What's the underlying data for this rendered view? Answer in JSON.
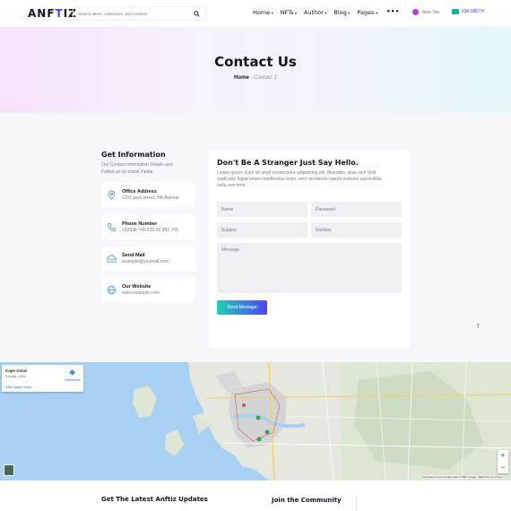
{
  "header": {
    "logo": {
      "main": "ANF",
      "accent": "T",
      "rest": "IZ"
    },
    "search_placeholder": "Search items, collections, and creators",
    "nav": [
      {
        "label": "Home",
        "caret": "▾"
      },
      {
        "label": "NFTs",
        "caret": "▾"
      },
      {
        "label": "Author",
        "caret": "▾"
      },
      {
        "label": "Blog",
        "caret": "▾"
      },
      {
        "label": "Pages",
        "caret": "▾"
      }
    ],
    "more": "•••",
    "user_name": "Alex Joe",
    "wallet_balance": "234.98ETH"
  },
  "hero": {
    "title": "Contact Us",
    "breadcrumb_home": "Home",
    "breadcrumb_sep": " - ",
    "breadcrumb_current": "Contact 2"
  },
  "info": {
    "title": "Get Information",
    "description": "Our Contact information Details and Follow us on social media",
    "cards": [
      {
        "label": "Office Address",
        "value": "1201 park street, 5th Avenue",
        "icon": "location-pin-icon"
      },
      {
        "label": "Phone Number",
        "value": "+22698 745 632,02 982 745",
        "icon": "phone-icon"
      },
      {
        "label": "Send Mail",
        "value": "example@youmail.com",
        "icon": "mail-icon"
      },
      {
        "label": "Our Website",
        "value": "www.example.com",
        "icon": "globe-icon"
      }
    ]
  },
  "form": {
    "title": "Don't Be A Stranger Just Say Hello.",
    "description": "Lorem ipsum dolor sit amet consectetur adipisicing elit. Blanditiis, alias sint! Velit explicabo fugiat totam repellendus enim, vero architecto harum maiores aut mollitia nulla eos error.",
    "name_placeholder": "Name",
    "password_placeholder": "Password",
    "subject_placeholder": "Subject",
    "number_placeholder": "Number",
    "message_placeholder": "Message",
    "send_label": "Send Message"
  },
  "scroll_top": "↑",
  "map": {
    "place": "Cape Coral",
    "region": "Florida, USA",
    "larger_map": "View larger map",
    "directions": "Directions",
    "zoom_in": "+",
    "zoom_out": "−",
    "attribution": "Keyboard shortcuts   Map data ©2022 Google, INEGI   Terms of Use"
  },
  "footer": {
    "updates_title": "Get The Latest Anftiz Updates",
    "community_title": "Join the Community"
  },
  "colors": {
    "brand": "#5142fc",
    "button_start": "#1fd0b4",
    "button_end": "#5142fc",
    "icon_blue": "#4a9fe0"
  }
}
